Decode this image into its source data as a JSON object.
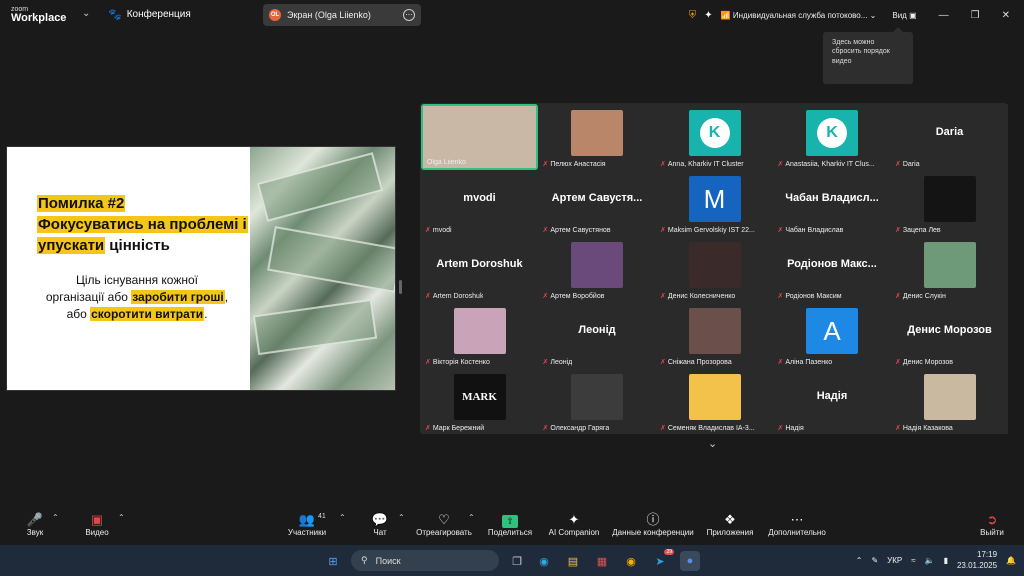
{
  "app": {
    "brand_top": "zoom",
    "brand_main": "Workplace",
    "conference_label": "Конференция",
    "share_pill": {
      "initials": "OL",
      "label": "Экран (Olga Liienko)"
    },
    "service": "Индивидуальная служба потоково...",
    "view_label": "Вид",
    "tooltip": "Здесь можно сбросить порядок видео"
  },
  "slide": {
    "title_line1": "Помилка #2",
    "title_line2": "Фокусуватись на проблемі і",
    "title_line3a": "упускати",
    "title_line3b": " цінність",
    "body_line1": "Ціль існування кожної",
    "body_line2a": "організації або ",
    "body_line2b": "заробити гроші",
    "body_line2c": ",",
    "body_line3a": "або ",
    "body_line3b": "скоротити витрати",
    "body_line3c": "."
  },
  "participants": [
    {
      "name": "Olga Liienko",
      "kind": "video",
      "color": "#c9b8a6",
      "muted": false
    },
    {
      "name": "Пелюх Анастасія",
      "kind": "photo",
      "color": "#b9866a",
      "muted": true
    },
    {
      "name": "Anna, Kharkiv IT Cluster",
      "kind": "kc",
      "muted": true
    },
    {
      "name": "Anastasiia, Kharkiv IT Clus...",
      "kind": "kc",
      "muted": true
    },
    {
      "name": "Daria",
      "kind": "text",
      "big": "Daria",
      "muted": true
    },
    {
      "name": "mvodi",
      "kind": "text",
      "big": "mvodi",
      "muted": true
    },
    {
      "name": "Артем Савустянов",
      "kind": "text",
      "big": "Артем Савустя...",
      "muted": true
    },
    {
      "name": "Maksim Gervolskiy IST 22...",
      "kind": "letter",
      "letter": "M",
      "color": "#1565c0",
      "muted": true
    },
    {
      "name": "Чабан Владислав",
      "kind": "text",
      "big": "Чабан Владисл...",
      "muted": true
    },
    {
      "name": "Зацепа Лев",
      "kind": "photo",
      "color": "#141414",
      "muted": true
    },
    {
      "name": "Artem Doroshuk",
      "kind": "text",
      "big": "Artem Doroshuk",
      "muted": true
    },
    {
      "name": "Артем Воробйов",
      "kind": "photo",
      "color": "#6a4a7a",
      "muted": true
    },
    {
      "name": "Денис Колесниченко",
      "kind": "photo",
      "color": "#3b2a2a",
      "muted": true
    },
    {
      "name": "Родіонов Максим",
      "kind": "text",
      "big": "Родіонов Макс...",
      "muted": true
    },
    {
      "name": "Денис Слукін",
      "kind": "photo",
      "color": "#6e9a7a",
      "muted": true
    },
    {
      "name": "Вікторія Костенко",
      "kind": "photo",
      "color": "#c9a3b8",
      "muted": true
    },
    {
      "name": "Леонід",
      "kind": "text",
      "big": "Леонід",
      "muted": true
    },
    {
      "name": "Сніжана Прозорова",
      "kind": "photo",
      "color": "#6b4f4a",
      "muted": true
    },
    {
      "name": "Аліна Пазенко",
      "kind": "letter",
      "letter": "A",
      "color": "#1e88e5",
      "muted": true
    },
    {
      "name": "Денис Морозов",
      "kind": "text",
      "big": "Денис Морозов",
      "muted": true
    },
    {
      "name": "Марк Бережний",
      "kind": "mark",
      "letter": "MARK",
      "color": "#111",
      "muted": true
    },
    {
      "name": "Олександр Гаряга",
      "kind": "photo",
      "color": "#3c3c3c",
      "muted": true
    },
    {
      "name": "Семеняк Владислав ІА-3...",
      "kind": "photo",
      "color": "#f2c24b",
      "muted": true
    },
    {
      "name": "Надія",
      "kind": "text",
      "big": "Надія",
      "muted": true
    },
    {
      "name": "Надія Казакова",
      "kind": "photo",
      "color": "#c8b9a0",
      "muted": true
    }
  ],
  "toolbar": {
    "audio": "Звук",
    "video": "Видео",
    "participants": "Участники",
    "participants_count": "41",
    "chat": "Чат",
    "react": "Отреагировать",
    "share": "Поделиться",
    "ai": "AI Companion",
    "info": "Данные конференции",
    "apps": "Приложения",
    "more": "Дополнительно",
    "leave": "Выйти"
  },
  "taskbar": {
    "search": "Поиск",
    "lang": "УКР",
    "time": "17:19",
    "date": "23.01.2025",
    "badge": "29"
  }
}
